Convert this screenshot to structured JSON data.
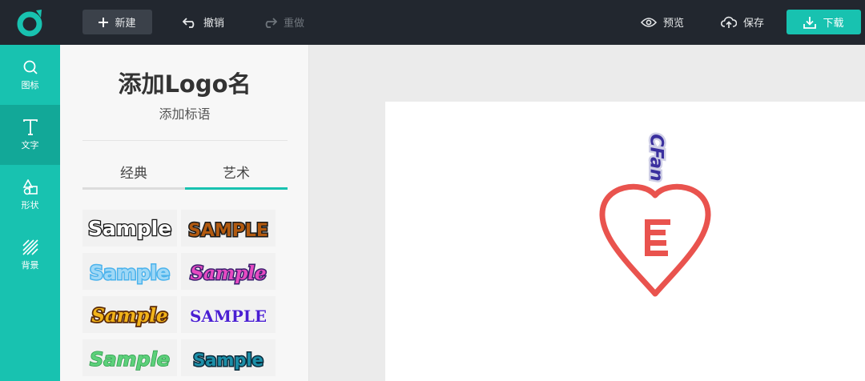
{
  "toolbar": {
    "new_label": "新建",
    "undo_label": "撤销",
    "redo_label": "重做",
    "preview_label": "预览",
    "save_label": "保存",
    "download_label": "下载"
  },
  "sidebar": {
    "items": [
      {
        "label": "图标",
        "icon": "search-icon"
      },
      {
        "label": "文字",
        "icon": "text-icon"
      },
      {
        "label": "形状",
        "icon": "shapes-icon"
      },
      {
        "label": "背景",
        "icon": "background-icon"
      }
    ],
    "active_index": 1
  },
  "text_panel": {
    "logo_name": "添加Logo名",
    "slogan": "添加标语",
    "tabs": [
      "经典",
      "艺术"
    ],
    "active_tab": 1,
    "samples": [
      "Sample",
      "SAMPLE",
      "Sample",
      "Sample",
      "Sample",
      "SAMPLE",
      "Sample",
      "Sample"
    ]
  },
  "canvas": {
    "logo_text": "CFan",
    "icon": "heart-icon"
  },
  "colors": {
    "accent": "#18c2b0",
    "topbar": "#22272f",
    "heart": "#e9534e",
    "logo_text": "#3a2f9e"
  }
}
